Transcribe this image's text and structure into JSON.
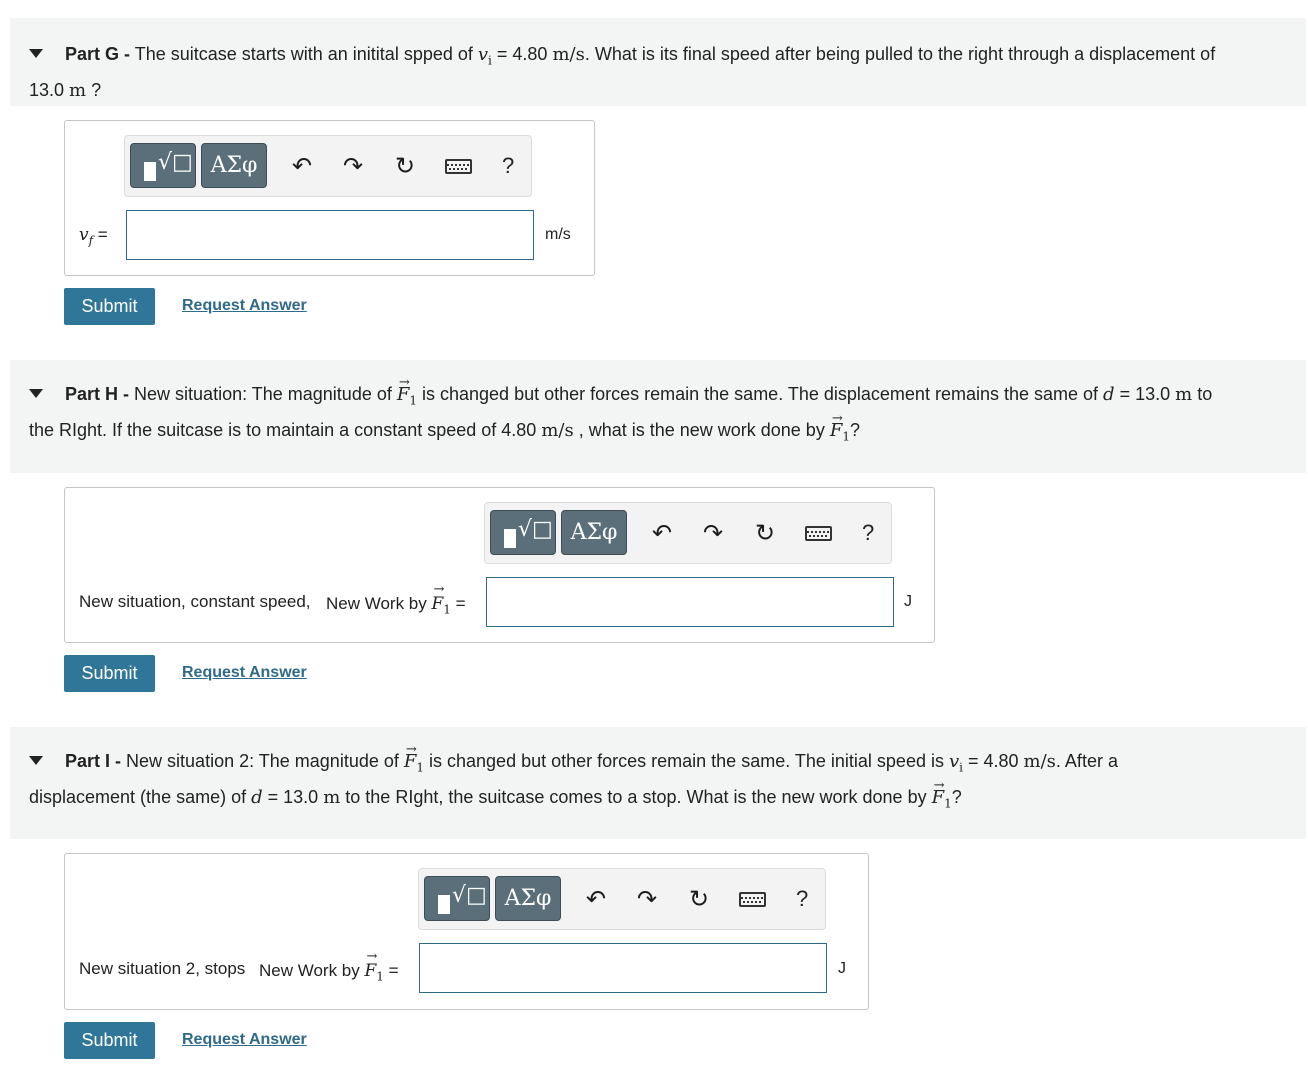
{
  "parts": [
    {
      "id": "G",
      "label": "Part G -",
      "text1": "The suitcase starts with an initital spped of ",
      "vi_var": "v",
      "vi_sub": "i",
      "eq": " = 4.80 ",
      "unit_ms": "m/s",
      "text2": ". What is its final speed after being pulled to the right through a displacement of",
      "text3": "13.0 ",
      "unit_m": "m",
      "text4": " ?",
      "field_label_var": "v",
      "field_label_sub": "f",
      "field_label_eq": " =",
      "input_value": "",
      "unit": "m/s"
    },
    {
      "id": "H",
      "label": "Part H -",
      "text1": "New situation: The magnitude of ",
      "F_var": "F",
      "F_sub": "1",
      "text2": " is changed but other forces remain the same. The displacement remains the same of ",
      "d_var": "d",
      "text3": " = 13.0 ",
      "unit_m": "m",
      "text4": " to",
      "line2a": "the RIght. If the suitcase is to maintain a constant speed of 4.80 ",
      "unit_ms": "m/s",
      "line2b": " , what is the new work done by ",
      "line2c": "?",
      "field_prefix": "New situation, constant speed,",
      "field_label_text": "New Work by ",
      "field_label_eq": " =",
      "input_value": "",
      "unit": "J"
    },
    {
      "id": "I",
      "label": "Part I -",
      "text1": "New situation 2: The magnitude of ",
      "F_var": "F",
      "F_sub": "1",
      "text2": " is changed but other forces remain the same. The initial speed is ",
      "vi_var": "v",
      "vi_sub": "i",
      "text3": " = 4.80 ",
      "unit_ms": "m/s",
      "text4": ". After a",
      "line2a": "displacement (the same) of ",
      "d_var": "d",
      "line2b": " = 13.0 ",
      "unit_m": "m",
      "line2c": " to the RIght, the suitcase comes to a stop. What is the new work done by ",
      "line2d": "?",
      "field_prefix": "New situation 2, stops",
      "field_label_text": "New Work by ",
      "field_label_eq": " =",
      "input_value": "",
      "unit": "J"
    }
  ],
  "toolbar": {
    "templates_icon": "sqrt-template-icon",
    "greek_label": "ΑΣφ",
    "undo_icon": "undo-icon",
    "redo_icon": "redo-icon",
    "reset_icon": "reset-icon",
    "keyboard_icon": "keyboard-icon",
    "help_label": "?"
  },
  "buttons": {
    "submit": "Submit",
    "request_answer": "Request Answer"
  },
  "colors": {
    "header_bg": "#f3f4f4",
    "submit_bg": "#2f7699",
    "link": "#2f6a8a",
    "toolbar_btn": "#5a6f79",
    "input_border": "#2e6b87"
  }
}
